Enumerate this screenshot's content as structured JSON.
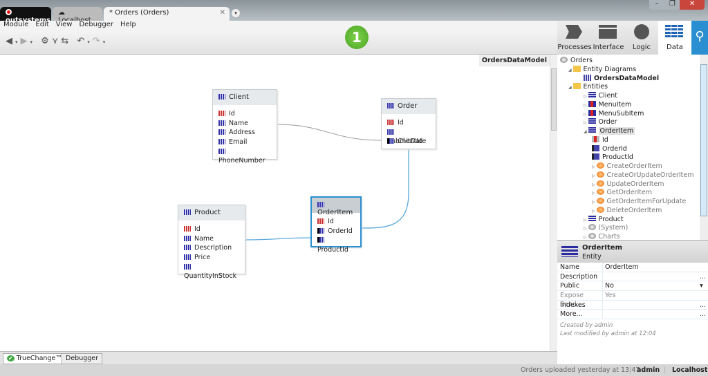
{
  "tabs": {
    "brand": "outsystems",
    "server": "Localhost",
    "doc": "* Orders (Orders)"
  },
  "menu": [
    "Module",
    "Edit",
    "View",
    "Debugger",
    "Help"
  ],
  "badge": "1",
  "nav": {
    "processes": "Processes",
    "interface": "Interface",
    "logic": "Logic",
    "data": "Data"
  },
  "diagram_name": "OrdersDataModel",
  "entities": {
    "client": {
      "name": "Client",
      "attrs": [
        "Id",
        "Name",
        "Address",
        "Email",
        "PhoneNumber"
      ]
    },
    "order": {
      "name": "Order",
      "attrs": [
        "Id",
        "SubmitDate",
        "ClientId"
      ]
    },
    "product": {
      "name": "Product",
      "attrs": [
        "Id",
        "Name",
        "Description",
        "Price",
        "QuantityInStock"
      ]
    },
    "orderitem": {
      "name": "OrderItem",
      "attrs": [
        "Id",
        "OrderId",
        "ProductId"
      ]
    }
  },
  "tree": [
    {
      "label": "Orders",
      "lvl": 0,
      "icon": "module"
    },
    {
      "label": "Entity Diagrams",
      "lvl": 1,
      "icon": "folder"
    },
    {
      "label": "OrdersDataModel",
      "lvl": 2,
      "icon": "diagram",
      "bold": true
    },
    {
      "label": "Entities",
      "lvl": 1,
      "icon": "folder"
    },
    {
      "label": "Client",
      "lvl": 2,
      "icon": "entity"
    },
    {
      "label": "MenuItem",
      "lvl": 2,
      "icon": "static"
    },
    {
      "label": "MenuSubItem",
      "lvl": 2,
      "icon": "static"
    },
    {
      "label": "Order",
      "lvl": 2,
      "icon": "entity"
    },
    {
      "label": "OrderItem",
      "lvl": 2,
      "icon": "entity",
      "selected": true
    },
    {
      "label": "Id",
      "lvl": 3,
      "icon": "pk"
    },
    {
      "label": "OrderId",
      "lvl": 3,
      "icon": "fk"
    },
    {
      "label": "ProductId",
      "lvl": 3,
      "icon": "fk"
    },
    {
      "label": "CreateOrderItem",
      "lvl": 3,
      "icon": "action",
      "gray": true
    },
    {
      "label": "CreateOrUpdateOrderItem",
      "lvl": 3,
      "icon": "action",
      "gray": true
    },
    {
      "label": "UpdateOrderItem",
      "lvl": 3,
      "icon": "action",
      "gray": true
    },
    {
      "label": "GetOrderItem",
      "lvl": 3,
      "icon": "action",
      "gray": true
    },
    {
      "label": "GetOrderItemForUpdate",
      "lvl": 3,
      "icon": "action",
      "gray": true
    },
    {
      "label": "DeleteOrderItem",
      "lvl": 3,
      "icon": "action",
      "gray": true
    },
    {
      "label": "Product",
      "lvl": 2,
      "icon": "entity"
    },
    {
      "label": "(System)",
      "lvl": 2,
      "icon": "module",
      "gray": true
    },
    {
      "label": "Charts",
      "lvl": 2,
      "icon": "module",
      "gray": true
    }
  ],
  "props": {
    "title": "OrderItem",
    "subtitle": "Entity",
    "rows": [
      {
        "k": "Name",
        "v": "OrderItem",
        "e": ""
      },
      {
        "k": "Description",
        "v": "",
        "e": "..."
      },
      {
        "k": "Public",
        "v": "No",
        "e": "▾"
      },
      {
        "k": "Expose Read...",
        "v": "Yes",
        "e": "",
        "gray": true
      },
      {
        "k": "Indexes",
        "v": "",
        "e": "..."
      },
      {
        "k": "More...",
        "v": "",
        "e": "..."
      }
    ],
    "created": "Created by admin",
    "modified": "Last modified by admin at 12:04"
  },
  "bottom_tabs": [
    "TrueChange™",
    "Debugger"
  ],
  "status": {
    "msg": "Orders uploaded yesterday at 13:47",
    "user": "admin",
    "server": "Localhost"
  },
  "colors": {
    "accent": "#2a8fd0",
    "badge": "#5cb82e",
    "relation": "#5aa9dc"
  }
}
